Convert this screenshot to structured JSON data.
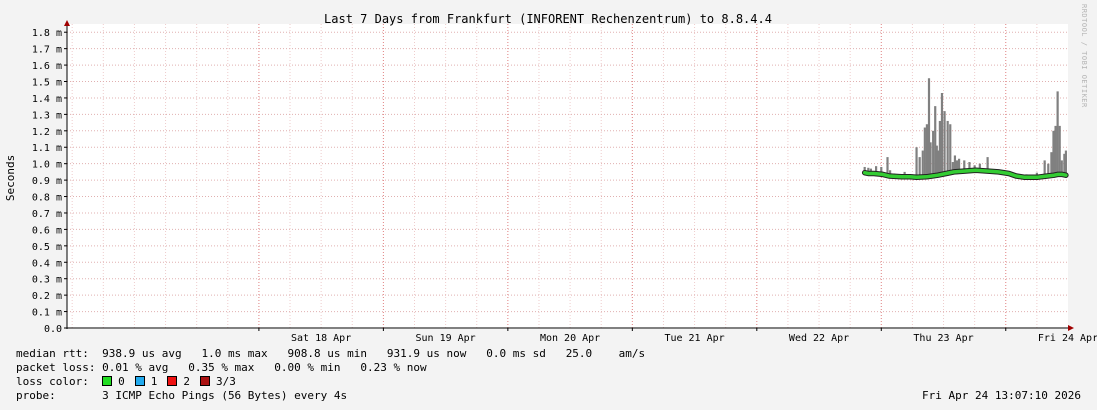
{
  "chart_data": {
    "type": "line",
    "title": "Last 7 Days from Frankfurt (INFORENT Rechenzentrum) to 8.8.4.4",
    "ylabel": "Seconds",
    "ylim": [
      0,
      1.85
    ],
    "yticks": [
      {
        "v": 0.0,
        "label": "0.0"
      },
      {
        "v": 0.1,
        "label": "0.1 m"
      },
      {
        "v": 0.2,
        "label": "0.2 m"
      },
      {
        "v": 0.3,
        "label": "0.3 m"
      },
      {
        "v": 0.4,
        "label": "0.4 m"
      },
      {
        "v": 0.5,
        "label": "0.5 m"
      },
      {
        "v": 0.6,
        "label": "0.6 m"
      },
      {
        "v": 0.7,
        "label": "0.7 m"
      },
      {
        "v": 0.8,
        "label": "0.8 m"
      },
      {
        "v": 0.9,
        "label": "0.9 m"
      },
      {
        "v": 1.0,
        "label": "1.0 m"
      },
      {
        "v": 1.1,
        "label": "1.1 m"
      },
      {
        "v": 1.2,
        "label": "1.2 m"
      },
      {
        "v": 1.3,
        "label": "1.3 m"
      },
      {
        "v": 1.4,
        "label": "1.4 m"
      },
      {
        "v": 1.5,
        "label": "1.5 m"
      },
      {
        "v": 1.6,
        "label": "1.6 m"
      },
      {
        "v": 1.7,
        "label": "1.7 m"
      },
      {
        "v": 1.8,
        "label": "1.8 m"
      }
    ],
    "x_unit": "hours since Fri Apr 17 00:00",
    "xlim": [
      -13,
      180
    ],
    "xticks": [
      {
        "h": 36,
        "label": "Sat 18 Apr"
      },
      {
        "h": 60,
        "label": "Sun 19 Apr"
      },
      {
        "h": 84,
        "label": "Mon 20 Apr"
      },
      {
        "h": 108,
        "label": "Tue 21 Apr"
      },
      {
        "h": 132,
        "label": "Wed 22 Apr"
      },
      {
        "h": 156,
        "label": "Thu 23 Apr"
      },
      {
        "h": 180,
        "label": "Fri 24 Apr"
      }
    ],
    "major_grid_hours": [
      24,
      48,
      72,
      96,
      120,
      144,
      168
    ],
    "minor_grid_step_hours": 6,
    "grid": true,
    "series": [
      {
        "name": "median rtt",
        "color": "#33cc33",
        "x": [
          140.8,
          141.5,
          142.6,
          144.3,
          145.5,
          147.9,
          149.6,
          150.8,
          152.7,
          153.8,
          154.9,
          156.5,
          158.0,
          160.0,
          162.2,
          164.6,
          166.6,
          168.6,
          170.0,
          171.5,
          172.4,
          174.2,
          176.0,
          177.3,
          178.0,
          178.9,
          179.6
        ],
        "values": [
          0.945,
          0.94,
          0.94,
          0.935,
          0.925,
          0.92,
          0.92,
          0.918,
          0.92,
          0.925,
          0.93,
          0.94,
          0.95,
          0.955,
          0.96,
          0.955,
          0.95,
          0.94,
          0.925,
          0.918,
          0.917,
          0.918,
          0.925,
          0.93,
          0.935,
          0.935,
          0.93
        ]
      },
      {
        "name": "max rtt",
        "color": "#808080",
        "x": [
          140.8,
          141.5,
          142.0,
          143.0,
          144.0,
          145.2,
          145.7,
          146.5,
          148.5,
          150.8,
          151.4,
          152.0,
          152.4,
          152.8,
          153.2,
          153.5,
          154.0,
          154.4,
          154.7,
          155.0,
          155.3,
          155.7,
          156.2,
          156.8,
          157.3,
          157.8,
          158.2,
          158.6,
          159.0,
          160.0,
          161.0,
          162.0,
          163.0,
          164.5,
          165.0,
          166.0,
          168.0,
          170.0,
          172.0,
          174.0,
          175.5,
          176.2,
          176.8,
          177.2,
          177.6,
          178.0,
          178.4,
          178.8,
          179.3,
          179.6
        ],
        "values": [
          0.98,
          0.975,
          0.97,
          0.985,
          0.98,
          1.04,
          0.96,
          0.94,
          0.95,
          1.1,
          1.04,
          1.08,
          1.22,
          1.24,
          1.52,
          1.13,
          1.2,
          1.35,
          1.11,
          1.08,
          1.26,
          1.43,
          1.32,
          1.26,
          1.24,
          1.01,
          1.05,
          1.02,
          1.03,
          1.02,
          1.01,
          0.99,
          1.0,
          1.04,
          0.96,
          0.945,
          0.94,
          0.94,
          0.935,
          0.945,
          1.02,
          1.0,
          1.07,
          1.2,
          1.23,
          1.44,
          1.23,
          1.02,
          1.06,
          1.08
        ]
      }
    ]
  },
  "legend": {
    "median_rtt_label": "median rtt:",
    "median_rtt_values": "938.9 us avg   1.0 ms max   908.8 us min   931.9 us now   0.0 ms sd   25.0    am/s",
    "packet_loss_label": "packet loss:",
    "packet_loss_values": "0.01 % avg   0.35 % max   0.00 % min   0.23 % now",
    "loss_color_label": "loss color:",
    "loss_colors": [
      {
        "label": "0",
        "color": "#22dd22"
      },
      {
        "label": "1",
        "color": "#22aaee"
      },
      {
        "label": "2",
        "color": "#ee1111"
      },
      {
        "label": "3/3",
        "color": "#aa1111"
      }
    ],
    "probe_label": "probe:",
    "probe_value": "3 ICMP Echo Pings (56 Bytes) every 4s",
    "timestamp": "Fri Apr 24 13:07:10 2026"
  },
  "watermark": "RRDTOOL / TOBI OETIKER"
}
